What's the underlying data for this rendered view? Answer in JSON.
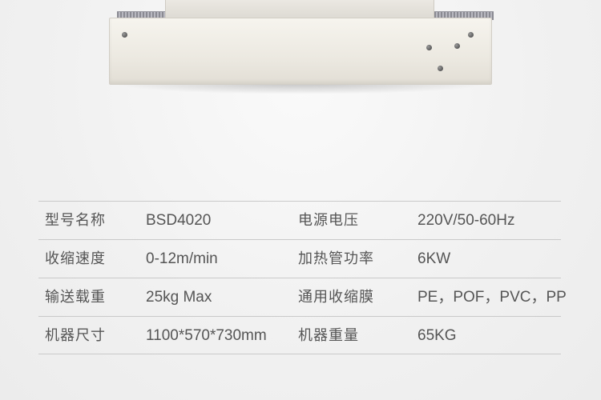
{
  "specs": [
    {
      "label1": "型号名称",
      "value1": "BSD4020",
      "label2": "电源电压",
      "value2": "220V/50-60Hz"
    },
    {
      "label1": "收缩速度",
      "value1": "0-12m/min",
      "label2": "加热管功率",
      "value2": "6KW"
    },
    {
      "label1": "输送载重",
      "value1": "25kg Max",
      "label2": "通用收缩膜",
      "value2": "PE，POF，PVC，PP"
    },
    {
      "label1": "机器尺寸",
      "value1": "1100*570*730mm",
      "label2": "机器重量",
      "value2": "65KG"
    }
  ],
  "colors": {
    "background": "#f3f3f3",
    "text": "#555555",
    "rule": "#c9c9c9"
  }
}
